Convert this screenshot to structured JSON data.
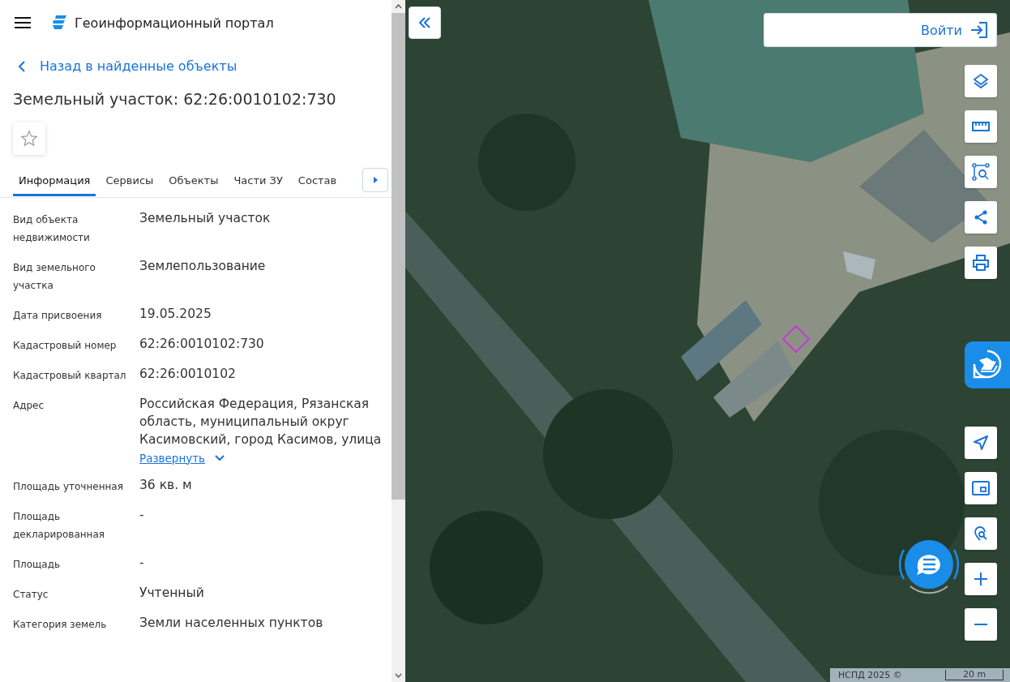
{
  "header": {
    "title": "Геоинформационный портал"
  },
  "back_link": "Назад в найденные объекты",
  "object_title": "Земельный участок: 62:26:0010102:730",
  "favorite": {
    "selected": false
  },
  "tabs": [
    {
      "label": "Информация",
      "selected": true
    },
    {
      "label": "Сервисы",
      "selected": false
    },
    {
      "label": "Объекты",
      "selected": false
    },
    {
      "label": "Части ЗУ",
      "selected": false
    },
    {
      "label": "Состав",
      "selected": false
    }
  ],
  "fields": [
    {
      "label": "Вид объекта недвижимости",
      "value": "Земельный участок"
    },
    {
      "label": "Вид земельного участка",
      "value": "Землепользование"
    },
    {
      "label": "Дата присвоения",
      "value": "19.05.2025"
    },
    {
      "label": "Кадастровый номер",
      "value": "62:26:0010102:730"
    },
    {
      "label": "Кадастровый квартал",
      "value": "62:26:0010102"
    },
    {
      "label": "Адрес",
      "value": "Российская Федерация, Рязанская область, муниципальный округ Касимовский, город Касимов, улица",
      "expand_link": "Развернуть"
    },
    {
      "label": "Площадь уточненная",
      "value": "36 кв. м"
    },
    {
      "label": "Площадь декларированная",
      "value": "-"
    },
    {
      "label": "Площадь",
      "value": "-"
    },
    {
      "label": "Статус",
      "value": "Учтенный"
    },
    {
      "label": "Категория земель",
      "value": "Земли населенных пунктов"
    }
  ],
  "map": {
    "login_button": "Войти",
    "attribution": "НСПД 2025 ©",
    "scale": "20 m"
  }
}
